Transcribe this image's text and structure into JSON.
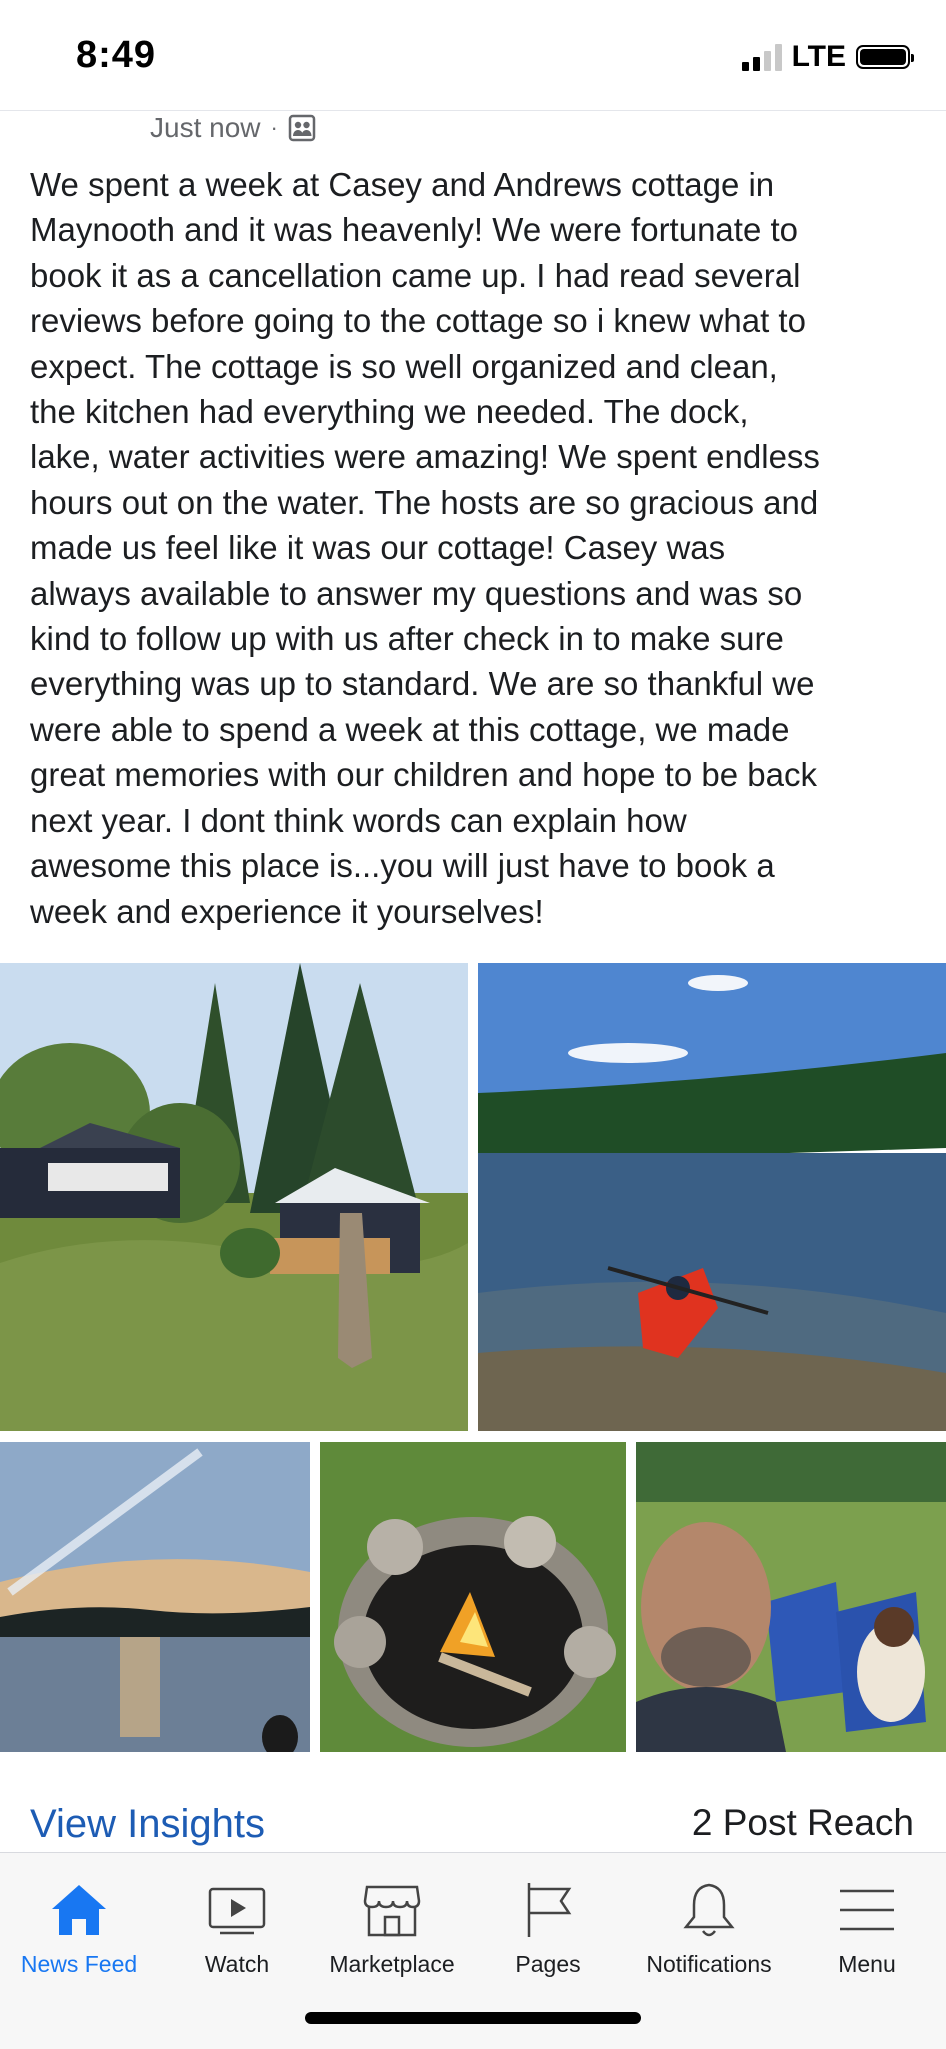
{
  "status_bar": {
    "time": "8:49",
    "network": "LTE"
  },
  "post": {
    "timestamp": "Just now",
    "separator": "·",
    "text": "We spent a week at Casey and Andrews cottage in\nMaynooth and it was heavenly! We were fortunate to\nbook it as a cancellation came up. I had read several\nreviews before going to the cottage so i knew what to\nexpect. The cottage is so well organized and clean,\nthe kitchen had everything we needed. The dock,\nlake, water activities were amazing! We spent endless\nhours out on the water.  The hosts are so gracious and\nmade us feel like it was our cottage! Casey was\nalways available to answer my questions and was so\nkind to follow up  with us after check in to make sure\neverything was up to standard. We are so thankful we\nwere able to spend a week at this cottage, we made\ngreat memories with our children and hope to be back\nnext year.  I dont think words can explain how\nawesome this place is...you will just have to book  a\nweek and experience it yourselves!"
  },
  "insights": {
    "view_label": "View Insights",
    "reach_label": "2 Post Reach"
  },
  "tab_bar": {
    "tabs": [
      {
        "label": "News Feed",
        "icon": "home-icon",
        "active": true
      },
      {
        "label": "Watch",
        "icon": "play-icon",
        "active": false
      },
      {
        "label": "Marketplace",
        "icon": "storefront-icon",
        "active": false
      },
      {
        "label": "Pages",
        "icon": "flag-icon",
        "active": false
      },
      {
        "label": "Notifications",
        "icon": "bell-icon",
        "active": false
      },
      {
        "label": "Menu",
        "icon": "hamburger-icon",
        "active": false
      }
    ]
  },
  "colors": {
    "accent": "#1877f2",
    "link": "#1d5cb4",
    "muted": "#65676b"
  }
}
